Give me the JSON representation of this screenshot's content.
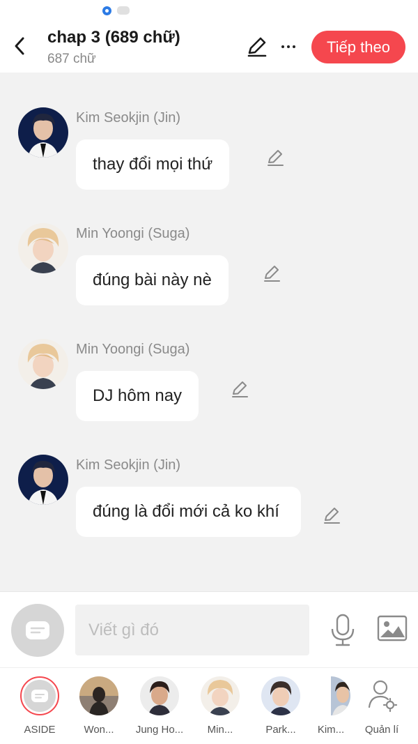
{
  "header": {
    "title": "chap 3 (689 chữ)",
    "subtitle": "687 chữ",
    "next_label": "Tiếp theo",
    "accent_color": "#f5474e"
  },
  "messages": [
    {
      "name": "Kim Seokjin (Jin)",
      "text": "thay đổi mọi thứ"
    },
    {
      "name": "Min Yoongi (Suga)",
      "text": "đúng bài này nè"
    },
    {
      "name": "Min Yoongi (Suga)",
      "text": "DJ hôm nay"
    },
    {
      "name": "Kim Seokjin (Jin)",
      "text": "đúng là đổi mới cả ko khí"
    }
  ],
  "composer": {
    "placeholder": "Viết gì đó"
  },
  "characters": [
    {
      "label": "ASIDE"
    },
    {
      "label": "Won..."
    },
    {
      "label": "Jung Ho..."
    },
    {
      "label": "Min..."
    },
    {
      "label": "Park..."
    },
    {
      "label": "Kim..."
    },
    {
      "label": "Quản lí"
    }
  ],
  "icons": [
    "back-icon",
    "pencil-icon",
    "more-icon",
    "microphone-icon",
    "image-icon",
    "compose-icon",
    "manage-user-icon"
  ]
}
